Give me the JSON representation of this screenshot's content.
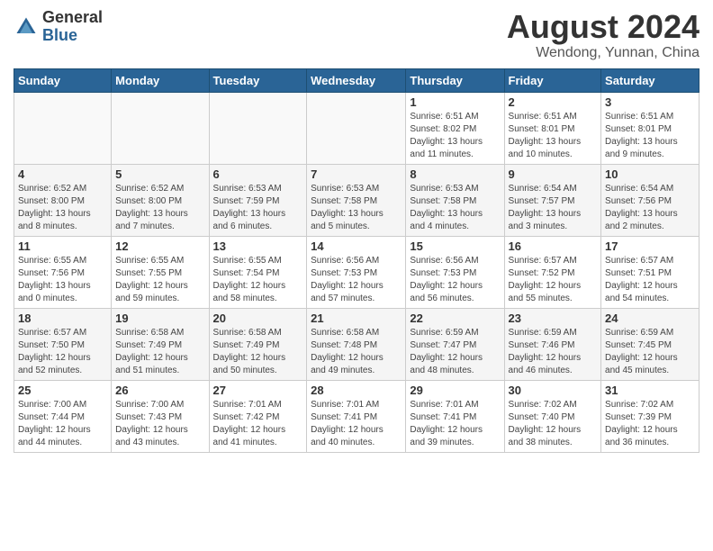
{
  "header": {
    "logo_general": "General",
    "logo_blue": "Blue",
    "month_year": "August 2024",
    "location": "Wendong, Yunnan, China"
  },
  "days_of_week": [
    "Sunday",
    "Monday",
    "Tuesday",
    "Wednesday",
    "Thursday",
    "Friday",
    "Saturday"
  ],
  "weeks": [
    [
      {
        "day": "",
        "info": ""
      },
      {
        "day": "",
        "info": ""
      },
      {
        "day": "",
        "info": ""
      },
      {
        "day": "",
        "info": ""
      },
      {
        "day": "1",
        "info": "Sunrise: 6:51 AM\nSunset: 8:02 PM\nDaylight: 13 hours\nand 11 minutes."
      },
      {
        "day": "2",
        "info": "Sunrise: 6:51 AM\nSunset: 8:01 PM\nDaylight: 13 hours\nand 10 minutes."
      },
      {
        "day": "3",
        "info": "Sunrise: 6:51 AM\nSunset: 8:01 PM\nDaylight: 13 hours\nand 9 minutes."
      }
    ],
    [
      {
        "day": "4",
        "info": "Sunrise: 6:52 AM\nSunset: 8:00 PM\nDaylight: 13 hours\nand 8 minutes."
      },
      {
        "day": "5",
        "info": "Sunrise: 6:52 AM\nSunset: 8:00 PM\nDaylight: 13 hours\nand 7 minutes."
      },
      {
        "day": "6",
        "info": "Sunrise: 6:53 AM\nSunset: 7:59 PM\nDaylight: 13 hours\nand 6 minutes."
      },
      {
        "day": "7",
        "info": "Sunrise: 6:53 AM\nSunset: 7:58 PM\nDaylight: 13 hours\nand 5 minutes."
      },
      {
        "day": "8",
        "info": "Sunrise: 6:53 AM\nSunset: 7:58 PM\nDaylight: 13 hours\nand 4 minutes."
      },
      {
        "day": "9",
        "info": "Sunrise: 6:54 AM\nSunset: 7:57 PM\nDaylight: 13 hours\nand 3 minutes."
      },
      {
        "day": "10",
        "info": "Sunrise: 6:54 AM\nSunset: 7:56 PM\nDaylight: 13 hours\nand 2 minutes."
      }
    ],
    [
      {
        "day": "11",
        "info": "Sunrise: 6:55 AM\nSunset: 7:56 PM\nDaylight: 13 hours\nand 0 minutes."
      },
      {
        "day": "12",
        "info": "Sunrise: 6:55 AM\nSunset: 7:55 PM\nDaylight: 12 hours\nand 59 minutes."
      },
      {
        "day": "13",
        "info": "Sunrise: 6:55 AM\nSunset: 7:54 PM\nDaylight: 12 hours\nand 58 minutes."
      },
      {
        "day": "14",
        "info": "Sunrise: 6:56 AM\nSunset: 7:53 PM\nDaylight: 12 hours\nand 57 minutes."
      },
      {
        "day": "15",
        "info": "Sunrise: 6:56 AM\nSunset: 7:53 PM\nDaylight: 12 hours\nand 56 minutes."
      },
      {
        "day": "16",
        "info": "Sunrise: 6:57 AM\nSunset: 7:52 PM\nDaylight: 12 hours\nand 55 minutes."
      },
      {
        "day": "17",
        "info": "Sunrise: 6:57 AM\nSunset: 7:51 PM\nDaylight: 12 hours\nand 54 minutes."
      }
    ],
    [
      {
        "day": "18",
        "info": "Sunrise: 6:57 AM\nSunset: 7:50 PM\nDaylight: 12 hours\nand 52 minutes."
      },
      {
        "day": "19",
        "info": "Sunrise: 6:58 AM\nSunset: 7:49 PM\nDaylight: 12 hours\nand 51 minutes."
      },
      {
        "day": "20",
        "info": "Sunrise: 6:58 AM\nSunset: 7:49 PM\nDaylight: 12 hours\nand 50 minutes."
      },
      {
        "day": "21",
        "info": "Sunrise: 6:58 AM\nSunset: 7:48 PM\nDaylight: 12 hours\nand 49 minutes."
      },
      {
        "day": "22",
        "info": "Sunrise: 6:59 AM\nSunset: 7:47 PM\nDaylight: 12 hours\nand 48 minutes."
      },
      {
        "day": "23",
        "info": "Sunrise: 6:59 AM\nSunset: 7:46 PM\nDaylight: 12 hours\nand 46 minutes."
      },
      {
        "day": "24",
        "info": "Sunrise: 6:59 AM\nSunset: 7:45 PM\nDaylight: 12 hours\nand 45 minutes."
      }
    ],
    [
      {
        "day": "25",
        "info": "Sunrise: 7:00 AM\nSunset: 7:44 PM\nDaylight: 12 hours\nand 44 minutes."
      },
      {
        "day": "26",
        "info": "Sunrise: 7:00 AM\nSunset: 7:43 PM\nDaylight: 12 hours\nand 43 minutes."
      },
      {
        "day": "27",
        "info": "Sunrise: 7:01 AM\nSunset: 7:42 PM\nDaylight: 12 hours\nand 41 minutes."
      },
      {
        "day": "28",
        "info": "Sunrise: 7:01 AM\nSunset: 7:41 PM\nDaylight: 12 hours\nand 40 minutes."
      },
      {
        "day": "29",
        "info": "Sunrise: 7:01 AM\nSunset: 7:41 PM\nDaylight: 12 hours\nand 39 minutes."
      },
      {
        "day": "30",
        "info": "Sunrise: 7:02 AM\nSunset: 7:40 PM\nDaylight: 12 hours\nand 38 minutes."
      },
      {
        "day": "31",
        "info": "Sunrise: 7:02 AM\nSunset: 7:39 PM\nDaylight: 12 hours\nand 36 minutes."
      }
    ]
  ]
}
